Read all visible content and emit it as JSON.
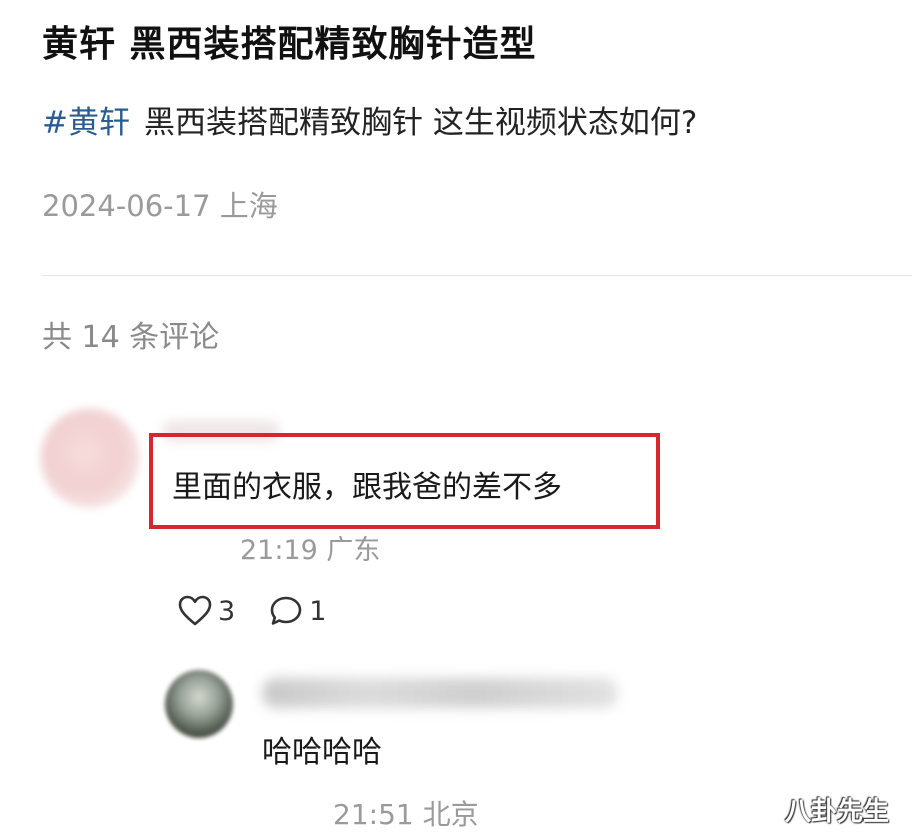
{
  "post": {
    "title": "黄轩  黑西装搭配精致胸针造型",
    "hashtag": "#黄轩",
    "body": "黑西装搭配精致胸针 这生视频状态如何?",
    "date_location": "2024-06-17 上海"
  },
  "comments_header": "共 14 条评论",
  "comment": {
    "text": "里面的衣服，跟我爸的差不多",
    "time_location": "21:19 广东",
    "like_icon": "heart-outline-icon",
    "likes": "3",
    "reply_icon": "speech-bubble-icon",
    "replies": "1",
    "highlight_color": "#d8262e"
  },
  "reply": {
    "text": "哈哈哈哈",
    "time_location": "21:51 北京"
  },
  "watermark": "八卦先生",
  "colors": {
    "hashtag": "#2b5b93",
    "meta_text": "#9a9a9a"
  }
}
